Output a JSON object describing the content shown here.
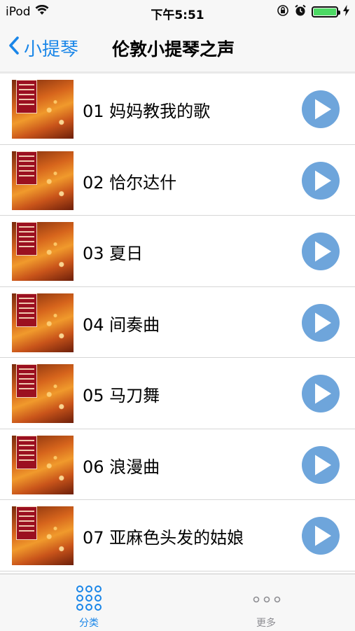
{
  "status_bar": {
    "carrier": "iPod",
    "time": "下午5:51",
    "battery_color": "#4cd964",
    "icons": [
      "wifi-icon",
      "rotation-lock-icon",
      "alarm-icon",
      "battery-icon",
      "charging-icon"
    ]
  },
  "nav": {
    "back_label": "小提琴",
    "title": "伦敦小提琴之声",
    "accent_color": "#1a86e8"
  },
  "tracks": [
    {
      "title": "01 妈妈教我的歌"
    },
    {
      "title": "02 恰尔达什"
    },
    {
      "title": "03 夏日"
    },
    {
      "title": "04 间奏曲"
    },
    {
      "title": "05 马刀舞"
    },
    {
      "title": "06 浪漫曲"
    },
    {
      "title": "07 亚麻色头发的姑娘"
    }
  ],
  "play_button_color": "#6ea5db",
  "tab_bar": {
    "tabs": [
      {
        "label": "分类",
        "icon": "grid-icon",
        "selected": true,
        "color": "#1a86e8"
      },
      {
        "label": "更多",
        "icon": "more-icon",
        "selected": false,
        "color": "#8e8e93"
      }
    ]
  }
}
